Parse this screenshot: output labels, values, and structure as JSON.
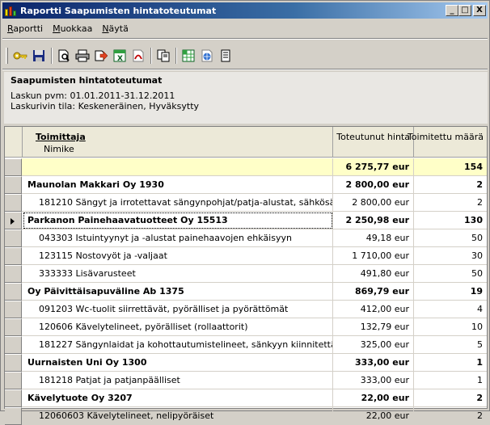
{
  "window": {
    "title": "Raportti Saapumisten hintatoteutumat",
    "minimize": "_",
    "maximize": "□",
    "close": "X"
  },
  "menu": [
    {
      "label": "Raportti",
      "underline": "R",
      "rest": "aportti"
    },
    {
      "label": "Muokkaa",
      "underline": "M",
      "rest": "uokkaa"
    },
    {
      "label": "Näytä",
      "underline": "N",
      "rest": "äytä"
    }
  ],
  "toolbar_icons": [
    "key-icon",
    "save-icon",
    "print-preview-icon",
    "print-icon",
    "export-icon",
    "excel-icon",
    "pdf-icon",
    "copy-icon",
    "spreadsheet-icon",
    "html-icon",
    "notes-icon"
  ],
  "info": {
    "heading": "Saapumisten hintatoteutumat",
    "line1": "Laskun pvm: 01.01.2011-31.12.2011",
    "line2": "Laskurivin tila: Keskeneräinen, Hyväksytty"
  },
  "columns": {
    "col1_title": "Toimittaja",
    "col1_sub": "Nimike",
    "col2": "Toteutunut hinta",
    "col3": "Toimitettu määrä"
  },
  "rows": [
    {
      "kind": "total",
      "name": "",
      "price": "6 275,77 eur",
      "qty": "154"
    },
    {
      "kind": "group",
      "name": "Maunolan Makkari Oy 1930",
      "price": "2 800,00 eur",
      "qty": "2"
    },
    {
      "kind": "item",
      "name": "181210 Sängyt ja irrotettavat sängynpohjat/patja-alustat, sähkösä",
      "price": "2 800,00 eur",
      "qty": "2"
    },
    {
      "kind": "group",
      "name": "Parkanon Painehaavatuotteet Oy 15513",
      "price": "2 250,98 eur",
      "qty": "130",
      "selected": true
    },
    {
      "kind": "item",
      "name": "043303 Istuintyynyt ja -alustat painehaavojen ehkäisyyn",
      "price": "49,18 eur",
      "qty": "50"
    },
    {
      "kind": "item",
      "name": "123115 Nostovyöt ja -valjaat",
      "price": "1 710,00 eur",
      "qty": "30"
    },
    {
      "kind": "item",
      "name": "333333 Lisävarusteet",
      "price": "491,80 eur",
      "qty": "50"
    },
    {
      "kind": "group",
      "name": "Oy Päivittäisapuväline Ab 1375",
      "price": "869,79 eur",
      "qty": "19"
    },
    {
      "kind": "item",
      "name": "091203 Wc-tuolit siirrettävät, pyörälliset ja pyörättömät",
      "price": "412,00 eur",
      "qty": "4"
    },
    {
      "kind": "item",
      "name": "120606 Kävelytelineet, pyörälliset (rollaattorit)",
      "price": "132,79 eur",
      "qty": "10"
    },
    {
      "kind": "item",
      "name": "181227 Sängynlaidat ja kohottautumistelineet, sänkyyn kiinnitettäv",
      "price": "325,00 eur",
      "qty": "5"
    },
    {
      "kind": "group",
      "name": "Uurnaisten Uni Oy 1300",
      "price": "333,00 eur",
      "qty": "1"
    },
    {
      "kind": "item",
      "name": "181218 Patjat ja patjanpäälliset",
      "price": "333,00 eur",
      "qty": "1"
    },
    {
      "kind": "group",
      "name": "Kävelytuote Oy 3207",
      "price": "22,00 eur",
      "qty": "2"
    },
    {
      "kind": "item",
      "name": "12060603 Kävelytelineet, nelipyöräiset",
      "price": "22,00 eur",
      "qty": "2"
    }
  ]
}
